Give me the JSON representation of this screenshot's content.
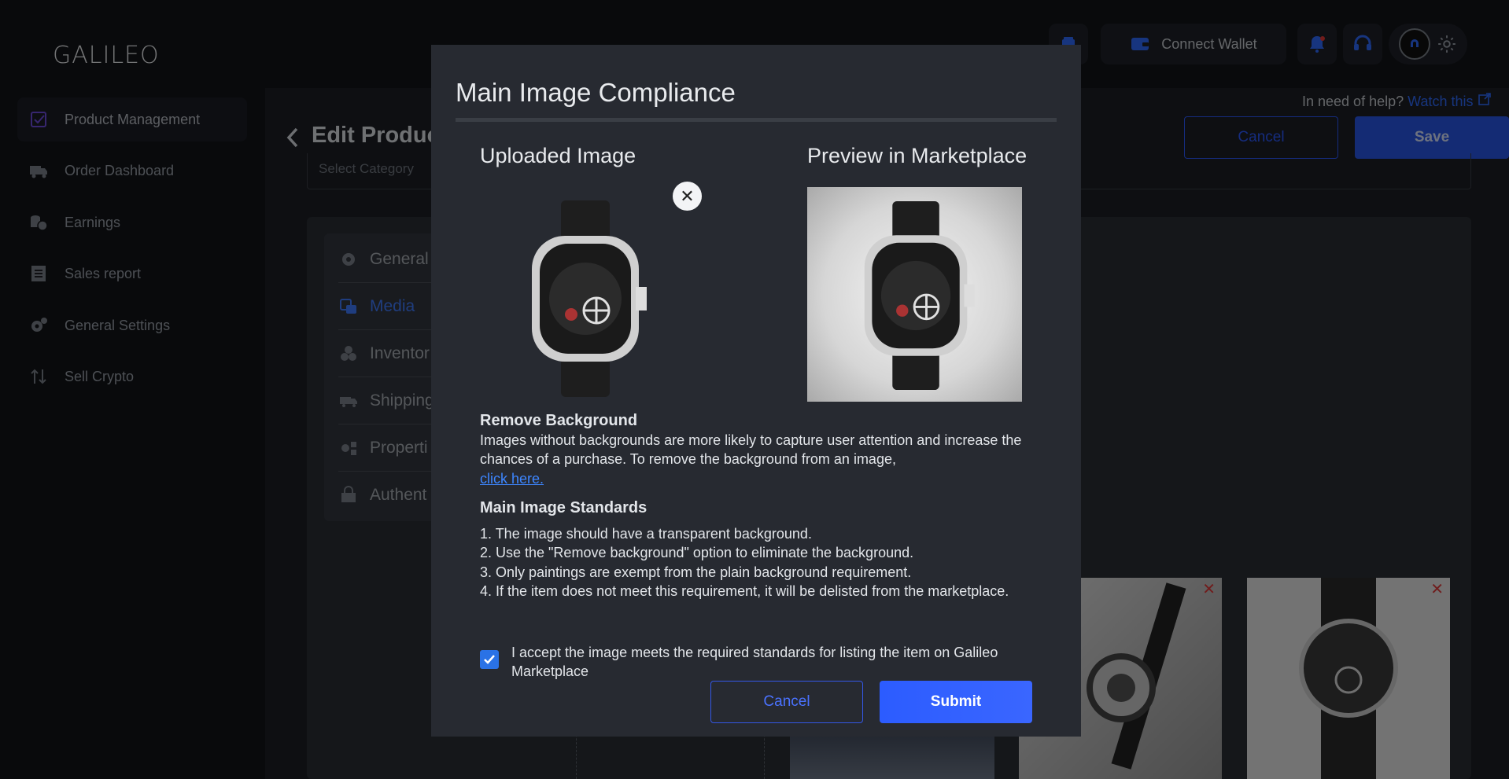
{
  "app": {
    "logo": "GALILEO"
  },
  "topbar": {
    "connect_wallet": "Connect Wallet"
  },
  "sidebar": {
    "items": [
      {
        "label": "Product Management",
        "icon": "checkbox-icon"
      },
      {
        "label": "Order Dashboard",
        "icon": "truck-icon"
      },
      {
        "label": "Earnings",
        "icon": "coins-icon"
      },
      {
        "label": "Sales report",
        "icon": "receipt-icon"
      },
      {
        "label": "General Settings",
        "icon": "gear-icon"
      },
      {
        "label": "Sell Crypto",
        "icon": "transfer-icon"
      }
    ]
  },
  "page": {
    "title": "Edit Produc",
    "help_text": "In need of help?",
    "help_link": "Watch this",
    "cancel": "Cancel",
    "save": "Save",
    "category_placeholder": "Select Category"
  },
  "tabs": [
    {
      "label": "General",
      "icon": "cog-icon"
    },
    {
      "label": "Media",
      "icon": "media-icon"
    },
    {
      "label": "Inventor",
      "icon": "cubes-icon"
    },
    {
      "label": "Shipping",
      "icon": "truck-icon"
    },
    {
      "label": "Properti",
      "icon": "properties-icon"
    },
    {
      "label": "Authent",
      "icon": "authentication-icon"
    }
  ],
  "modal": {
    "title": "Main Image Compliance",
    "uploaded_heading": "Uploaded Image",
    "preview_heading": "Preview in Marketplace",
    "remove_bg_heading": "Remove Background",
    "remove_bg_text": "Images without backgrounds are more likely to capture user attention and increase the chances of a purchase. To remove the background from an image,",
    "remove_bg_link": "click here.",
    "standards_heading": "Main Image Standards",
    "standards": [
      "1. The image should have a transparent background.",
      "2. Use the \"Remove background\" option to eliminate the background.",
      "3. Only paintings are exempt from the plain background requirement.",
      "4. If the item does not meet this requirement, it will be delisted from the marketplace."
    ],
    "accept_label": "I accept the image meets the required standards for listing the item on Galileo Marketplace",
    "accept_checked": true,
    "cancel": "Cancel",
    "submit": "Submit"
  },
  "colors": {
    "accent": "#2b58ff",
    "background": "#121418",
    "modal": "#272a31"
  }
}
